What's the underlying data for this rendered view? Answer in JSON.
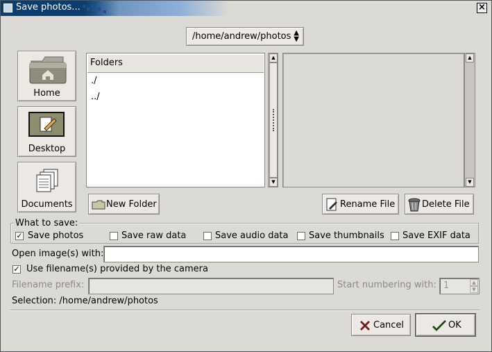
{
  "window": {
    "title": "Save photos..."
  },
  "path_combo": {
    "value": "/home/andrew/photos"
  },
  "sidebar": {
    "items": [
      {
        "label": "Home"
      },
      {
        "label": "Desktop"
      },
      {
        "label": "Documents"
      }
    ]
  },
  "folders": {
    "header": "Folders",
    "rows": [
      "./",
      "../"
    ]
  },
  "buttons": {
    "new_folder": "New Folder",
    "rename_file": "Rename File",
    "delete_file": "Delete File",
    "cancel": "Cancel",
    "ok": "OK"
  },
  "what_to_save": {
    "title": "What to save:",
    "options": [
      {
        "label": "Save photos",
        "checked": true
      },
      {
        "label": "Save raw data",
        "checked": false
      },
      {
        "label": "Save audio data",
        "checked": false
      },
      {
        "label": "Save thumbnails",
        "checked": false
      },
      {
        "label": "Save EXIF data",
        "checked": false
      }
    ]
  },
  "open_with": {
    "label": "Open image(s) with:",
    "value": ""
  },
  "use_filenames": {
    "label": "Use filename(s) provided by the camera",
    "checked": true
  },
  "filename_prefix": {
    "label": "Filename prefix:",
    "value": ""
  },
  "start_numbering": {
    "label": "Start numbering with:",
    "value": "1"
  },
  "selection": {
    "text": "Selection: /home/andrew/photos"
  }
}
